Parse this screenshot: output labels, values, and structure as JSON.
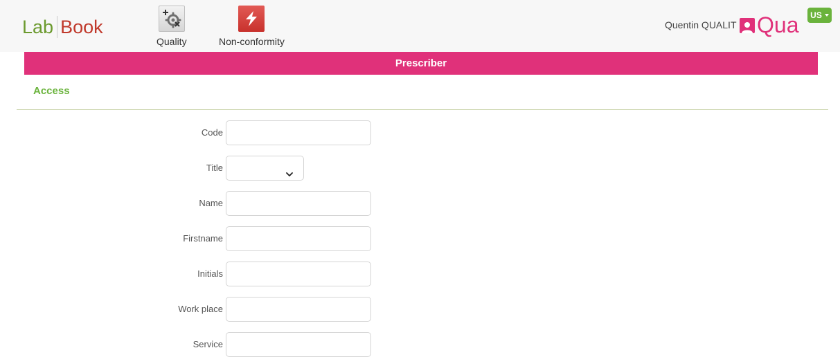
{
  "app": {
    "logo_left": "Lab",
    "logo_right": "Book"
  },
  "modules": [
    {
      "label": "Quality",
      "icon": "quality-gear-icon"
    },
    {
      "label": "Non-conformity",
      "icon": "lightning-icon"
    }
  ],
  "user": {
    "name": "Quentin QUALIT",
    "initials": "Qua",
    "avatar_icon": "user-avatar-icon"
  },
  "language": {
    "selected": "US"
  },
  "page": {
    "title": "Prescriber"
  },
  "section": {
    "title": "Access"
  },
  "form": {
    "fields": [
      {
        "label": "Code",
        "value": "",
        "placeholder": ""
      },
      {
        "label": "Title",
        "value": "",
        "type": "select"
      },
      {
        "label": "Name",
        "value": "",
        "placeholder": ""
      },
      {
        "label": "Firstname",
        "value": "",
        "placeholder": ""
      },
      {
        "label": "Initials",
        "value": "",
        "placeholder": ""
      },
      {
        "label": "Work place",
        "value": "",
        "placeholder": ""
      },
      {
        "label": "Service",
        "value": "",
        "placeholder": ""
      }
    ]
  },
  "colors": {
    "brand_pink": "#e0317a",
    "brand_green": "#6ab33c",
    "logo_red": "#c0392b"
  }
}
